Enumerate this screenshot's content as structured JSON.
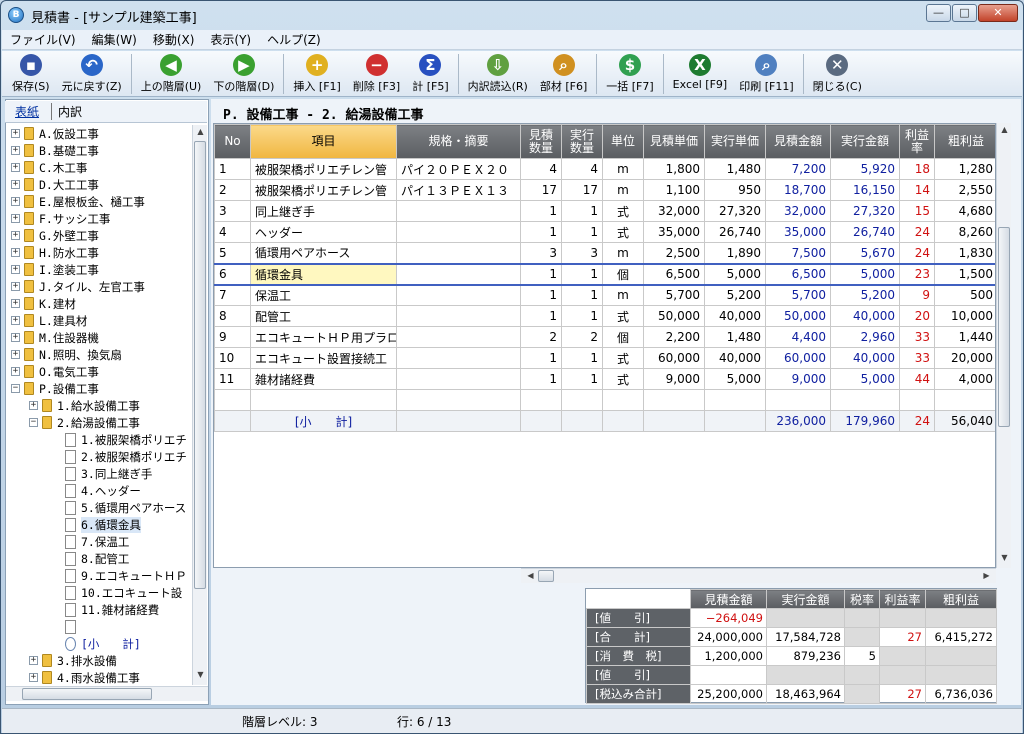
{
  "window": {
    "title": "見積書 - [サンプル建築工事]",
    "min": "—",
    "max": "□",
    "close": "✕",
    "app_icon": "B"
  },
  "menu": [
    "ファイル(V)",
    "編集(W)",
    "移動(X)",
    "表示(Y)",
    "ヘルプ(Z)"
  ],
  "toolbar": [
    {
      "id": "save",
      "label": "保存(S)",
      "icon": "floppy-icon",
      "glyph": "▪",
      "color": "#3656a8"
    },
    {
      "id": "undo",
      "label": "元に戻す(Z)",
      "icon": "undo-icon",
      "glyph": "↶",
      "color": "#2a66c8"
    },
    {
      "id": "up",
      "label": "上の階層(U)",
      "icon": "arrow-left-icon",
      "glyph": "◀",
      "color": "#3aa030"
    },
    {
      "id": "down",
      "label": "下の階層(D)",
      "icon": "arrow-right-icon",
      "glyph": "▶",
      "color": "#3aa030"
    },
    {
      "id": "insert",
      "label": "挿入 [F1]",
      "icon": "plus-icon",
      "glyph": "+",
      "color": "#e0b020"
    },
    {
      "id": "delete",
      "label": "削除 [F3]",
      "icon": "minus-icon",
      "glyph": "−",
      "color": "#d03030"
    },
    {
      "id": "sum",
      "label": "計 [F5]",
      "icon": "sigma-icon",
      "glyph": "Σ",
      "color": "#2850c0"
    },
    {
      "id": "import",
      "label": "内訳読込(R)",
      "icon": "import-icon",
      "glyph": "⇩",
      "color": "#60a040"
    },
    {
      "id": "parts",
      "label": "部材 [F6]",
      "icon": "magnifier-icon",
      "glyph": "⌕",
      "color": "#d09020"
    },
    {
      "id": "bulk",
      "label": "一括 [F7]",
      "icon": "coins-icon",
      "glyph": "$",
      "color": "#30a050"
    },
    {
      "id": "excel",
      "label": "Excel [F9]",
      "icon": "excel-icon",
      "glyph": "X",
      "color": "#1e7b30"
    },
    {
      "id": "print",
      "label": "印刷 [F11]",
      "icon": "print-preview-icon",
      "glyph": "⌕",
      "color": "#5080c0"
    },
    {
      "id": "close",
      "label": "閉じる(C)",
      "icon": "close-x-icon",
      "glyph": "✕",
      "color": "#5a6a80"
    }
  ],
  "left_tabs": {
    "tab1": "表紙",
    "tab2": "内訳"
  },
  "tree": [
    {
      "level": 0,
      "exp": "+",
      "type": "folder",
      "label": "A.仮設工事"
    },
    {
      "level": 0,
      "exp": "+",
      "type": "folder",
      "label": "B.基礎工事"
    },
    {
      "level": 0,
      "exp": "+",
      "type": "folder",
      "label": "C.木工事"
    },
    {
      "level": 0,
      "exp": "+",
      "type": "folder",
      "label": "D.大工工事"
    },
    {
      "level": 0,
      "exp": "+",
      "type": "folder",
      "label": "E.屋根板金、樋工事"
    },
    {
      "level": 0,
      "exp": "+",
      "type": "folder",
      "label": "F.サッシ工事"
    },
    {
      "level": 0,
      "exp": "+",
      "type": "folder",
      "label": "G.外壁工事"
    },
    {
      "level": 0,
      "exp": "+",
      "type": "folder",
      "label": "H.防水工事"
    },
    {
      "level": 0,
      "exp": "+",
      "type": "folder",
      "label": "I.塗装工事"
    },
    {
      "level": 0,
      "exp": "+",
      "type": "folder",
      "label": "J.タイル、左官工事"
    },
    {
      "level": 0,
      "exp": "+",
      "type": "folder",
      "label": "K.建材"
    },
    {
      "level": 0,
      "exp": "+",
      "type": "folder",
      "label": "L.建具材"
    },
    {
      "level": 0,
      "exp": "+",
      "type": "folder",
      "label": "M.住設器機"
    },
    {
      "level": 0,
      "exp": "+",
      "type": "folder",
      "label": "N.照明、換気扇"
    },
    {
      "level": 0,
      "exp": "+",
      "type": "folder",
      "label": "O.電気工事"
    },
    {
      "level": 0,
      "exp": "−",
      "type": "folder",
      "label": "P.設備工事"
    },
    {
      "level": 1,
      "exp": "+",
      "type": "folder",
      "label": "1.給水設備工事"
    },
    {
      "level": 1,
      "exp": "−",
      "type": "folder",
      "label": "2.給湯設備工事"
    },
    {
      "level": 2,
      "exp": "",
      "type": "doc",
      "label": "1.被服架橋ポリエチ"
    },
    {
      "level": 2,
      "exp": "",
      "type": "doc",
      "label": "2.被服架橋ポリエチ"
    },
    {
      "level": 2,
      "exp": "",
      "type": "doc",
      "label": "3.同上継ぎ手"
    },
    {
      "level": 2,
      "exp": "",
      "type": "doc",
      "label": "4.ヘッダー"
    },
    {
      "level": 2,
      "exp": "",
      "type": "doc",
      "label": "5.循環用ペアホース"
    },
    {
      "level": 2,
      "exp": "",
      "type": "doc",
      "label": "6.循環金具",
      "selected": true
    },
    {
      "level": 2,
      "exp": "",
      "type": "doc",
      "label": "7.保温工"
    },
    {
      "level": 2,
      "exp": "",
      "type": "doc",
      "label": "8.配管工"
    },
    {
      "level": 2,
      "exp": "",
      "type": "doc",
      "label": "9.エコキュートＨＰ"
    },
    {
      "level": 2,
      "exp": "",
      "type": "doc",
      "label": "10.エコキュート設"
    },
    {
      "level": 2,
      "exp": "",
      "type": "doc",
      "label": "11.雑材諸経費"
    },
    {
      "level": 2,
      "exp": "",
      "type": "doc",
      "label": ""
    },
    {
      "level": 2,
      "exp": "",
      "type": "gear",
      "label": "[小　　計]"
    },
    {
      "level": 1,
      "exp": "+",
      "type": "folder",
      "label": "3.排水設備"
    },
    {
      "level": 1,
      "exp": "+",
      "type": "folder",
      "label": "4.雨水設備工事"
    }
  ],
  "heading": "P. 設備工事 - 2. 給湯設備工事",
  "columns": [
    "No",
    "項目",
    "規格・摘要",
    "見積\n数量",
    "実行\n数量",
    "単位",
    "見積単価",
    "実行単価",
    "見積金額",
    "実行金額",
    "利益\n率",
    "粗利益"
  ],
  "rows": [
    {
      "no": "1",
      "item": "被服架橋ポリエチレン管",
      "spec": "パイ２０ＰＥＸ２０",
      "eq": "4",
      "aq": "4",
      "unit": "m",
      "ep": "1,800",
      "ap": "1,480",
      "ea": "7,200",
      "aa": "5,920",
      "rate": "18",
      "gp": "1,280"
    },
    {
      "no": "2",
      "item": "被服架橋ポリエチレン管",
      "spec": "パイ１３ＰＥＸ１３",
      "eq": "17",
      "aq": "17",
      "unit": "m",
      "ep": "1,100",
      "ap": "950",
      "ea": "18,700",
      "aa": "16,150",
      "rate": "14",
      "gp": "2,550"
    },
    {
      "no": "3",
      "item": "同上継ぎ手",
      "spec": "",
      "eq": "1",
      "aq": "1",
      "unit": "式",
      "ep": "32,000",
      "ap": "27,320",
      "ea": "32,000",
      "aa": "27,320",
      "rate": "15",
      "gp": "4,680"
    },
    {
      "no": "4",
      "item": "ヘッダー",
      "spec": "",
      "eq": "1",
      "aq": "1",
      "unit": "式",
      "ep": "35,000",
      "ap": "26,740",
      "ea": "35,000",
      "aa": "26,740",
      "rate": "24",
      "gp": "8,260"
    },
    {
      "no": "5",
      "item": "循環用ペアホース",
      "spec": "",
      "eq": "3",
      "aq": "3",
      "unit": "m",
      "ep": "2,500",
      "ap": "1,890",
      "ea": "7,500",
      "aa": "5,670",
      "rate": "24",
      "gp": "1,830"
    },
    {
      "no": "6",
      "item": "循環金具",
      "spec": "",
      "eq": "1",
      "aq": "1",
      "unit": "個",
      "ep": "6,500",
      "ap": "5,000",
      "ea": "6,500",
      "aa": "5,000",
      "rate": "23",
      "gp": "1,500",
      "selected": true
    },
    {
      "no": "7",
      "item": "保温工",
      "spec": "",
      "eq": "1",
      "aq": "1",
      "unit": "m",
      "ep": "5,700",
      "ap": "5,200",
      "ea": "5,700",
      "aa": "5,200",
      "rate": "9",
      "gp": "500"
    },
    {
      "no": "8",
      "item": "配管工",
      "spec": "",
      "eq": "1",
      "aq": "1",
      "unit": "式",
      "ep": "50,000",
      "ap": "40,000",
      "ea": "50,000",
      "aa": "40,000",
      "rate": "20",
      "gp": "10,000"
    },
    {
      "no": "9",
      "item": "エコキュートＨＰ用プラロ",
      "spec": "",
      "eq": "2",
      "aq": "2",
      "unit": "個",
      "ep": "2,200",
      "ap": "1,480",
      "ea": "4,400",
      "aa": "2,960",
      "rate": "33",
      "gp": "1,440"
    },
    {
      "no": "10",
      "item": "エコキュート設置接続工",
      "spec": "",
      "eq": "1",
      "aq": "1",
      "unit": "式",
      "ep": "60,000",
      "ap": "40,000",
      "ea": "60,000",
      "aa": "40,000",
      "rate": "33",
      "gp": "20,000"
    },
    {
      "no": "11",
      "item": "雑材諸経費",
      "spec": "",
      "eq": "1",
      "aq": "1",
      "unit": "式",
      "ep": "9,000",
      "ap": "5,000",
      "ea": "9,000",
      "aa": "5,000",
      "rate": "44",
      "gp": "4,000"
    },
    {
      "no": "",
      "item": "",
      "spec": "",
      "eq": "",
      "aq": "",
      "unit": "",
      "ep": "",
      "ap": "",
      "ea": "",
      "aa": "",
      "rate": "",
      "gp": ""
    },
    {
      "no": "",
      "item": "[小　　計]",
      "spec": "",
      "eq": "",
      "aq": "",
      "unit": "",
      "ep": "",
      "ap": "",
      "ea": "236,000",
      "aa": "179,960",
      "rate": "24",
      "gp": "56,040",
      "subtotal": true
    }
  ],
  "summary": {
    "headers": [
      "見積金額",
      "実行金額",
      "税率",
      "利益率",
      "粗利益"
    ],
    "rows": [
      {
        "label": "[値　　引]",
        "est": "−264,049",
        "act": "",
        "tax": "",
        "rate": "",
        "gp": "",
        "est_red": true
      },
      {
        "label": "[合　　計]",
        "est": "24,000,000",
        "act": "17,584,728",
        "tax": "",
        "rate": "27",
        "gp": "6,415,272"
      },
      {
        "label": "[消　費　税]",
        "est": "1,200,000",
        "act": "879,236",
        "tax": "5",
        "rate": "",
        "gp": ""
      },
      {
        "label": "[値　　引]",
        "est": "",
        "act": "",
        "tax": "",
        "rate": "",
        "gp": ""
      },
      {
        "label": "[税込み合計]",
        "est": "25,200,000",
        "act": "18,463,964",
        "tax": "",
        "rate": "27",
        "gp": "6,736,036"
      }
    ]
  },
  "status": {
    "level": "階層レベル: 3",
    "row": "行: 6 / 13"
  }
}
